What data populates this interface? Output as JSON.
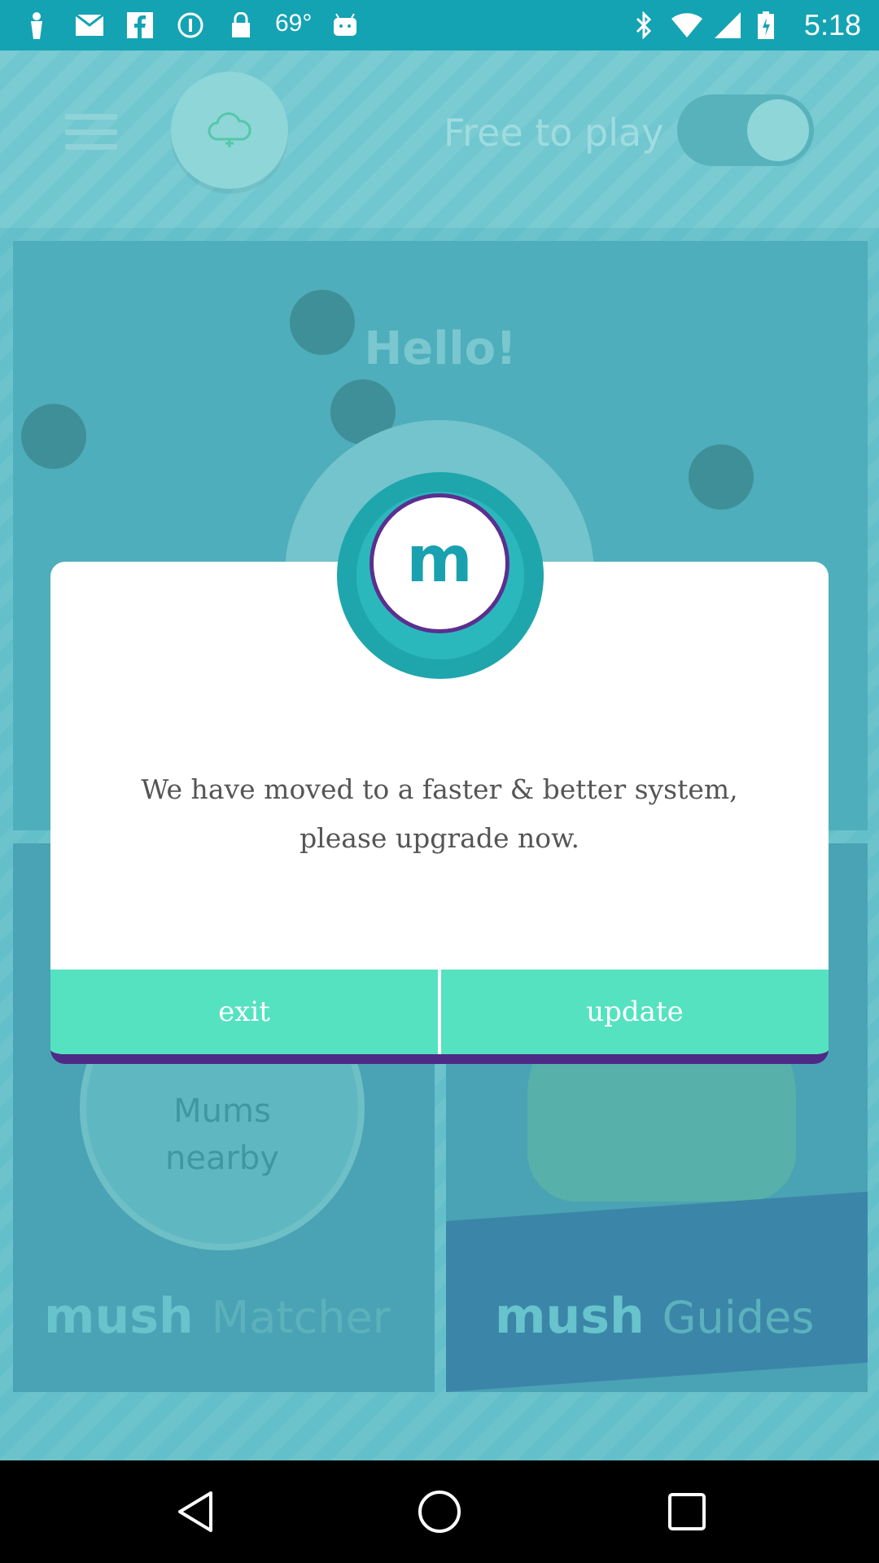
{
  "status_bar": {
    "temperature": "69°",
    "time": "5:18",
    "icons": [
      "person-icon",
      "mail-icon",
      "facebook-icon",
      "info-icon",
      "lock-icon",
      "android-icon",
      "bluetooth-icon",
      "wifi-icon",
      "signal-icon",
      "battery-icon"
    ]
  },
  "topbar": {
    "free_label": "Free to play",
    "toggle_on": true
  },
  "cards": {
    "hello": "Hello!",
    "mums_line1": "Mums",
    "mums_line2": "nearby",
    "matcher_brand": "mush",
    "matcher_name": "Matcher",
    "guides_brand": "mush",
    "guides_name": "Guides"
  },
  "dialog": {
    "badge_letter": "m",
    "message_line1": "We have moved to a faster & better system,",
    "message_line2": "please upgrade now.",
    "exit_label": "exit",
    "update_label": "update"
  },
  "navbar": {
    "icons": [
      "back-icon",
      "home-icon",
      "recents-icon"
    ]
  }
}
